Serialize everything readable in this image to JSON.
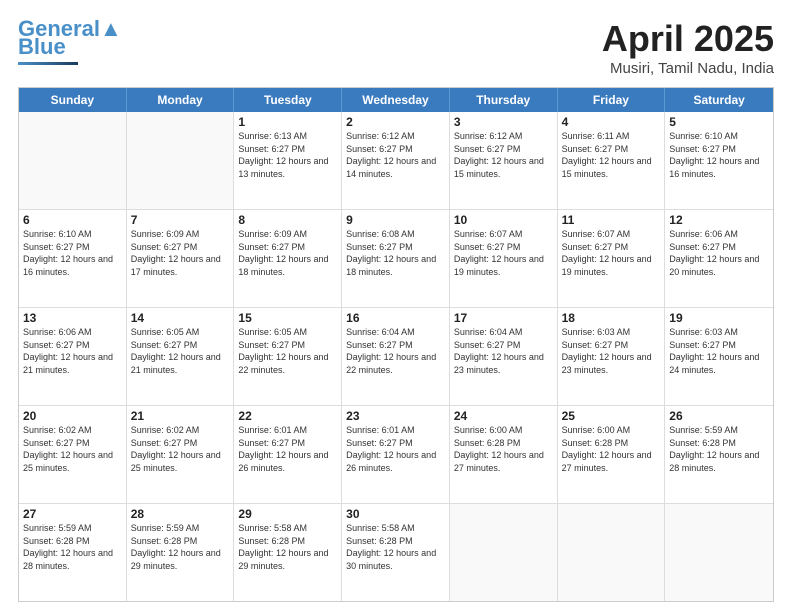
{
  "header": {
    "logo_line1": "General",
    "logo_line2": "Blue",
    "title": "April 2025",
    "subtitle": "Musiri, Tamil Nadu, India"
  },
  "days_of_week": [
    "Sunday",
    "Monday",
    "Tuesday",
    "Wednesday",
    "Thursday",
    "Friday",
    "Saturday"
  ],
  "weeks": [
    [
      {
        "day": "",
        "info": ""
      },
      {
        "day": "",
        "info": ""
      },
      {
        "day": "1",
        "info": "Sunrise: 6:13 AM\nSunset: 6:27 PM\nDaylight: 12 hours and 13 minutes."
      },
      {
        "day": "2",
        "info": "Sunrise: 6:12 AM\nSunset: 6:27 PM\nDaylight: 12 hours and 14 minutes."
      },
      {
        "day": "3",
        "info": "Sunrise: 6:12 AM\nSunset: 6:27 PM\nDaylight: 12 hours and 15 minutes."
      },
      {
        "day": "4",
        "info": "Sunrise: 6:11 AM\nSunset: 6:27 PM\nDaylight: 12 hours and 15 minutes."
      },
      {
        "day": "5",
        "info": "Sunrise: 6:10 AM\nSunset: 6:27 PM\nDaylight: 12 hours and 16 minutes."
      }
    ],
    [
      {
        "day": "6",
        "info": "Sunrise: 6:10 AM\nSunset: 6:27 PM\nDaylight: 12 hours and 16 minutes."
      },
      {
        "day": "7",
        "info": "Sunrise: 6:09 AM\nSunset: 6:27 PM\nDaylight: 12 hours and 17 minutes."
      },
      {
        "day": "8",
        "info": "Sunrise: 6:09 AM\nSunset: 6:27 PM\nDaylight: 12 hours and 18 minutes."
      },
      {
        "day": "9",
        "info": "Sunrise: 6:08 AM\nSunset: 6:27 PM\nDaylight: 12 hours and 18 minutes."
      },
      {
        "day": "10",
        "info": "Sunrise: 6:07 AM\nSunset: 6:27 PM\nDaylight: 12 hours and 19 minutes."
      },
      {
        "day": "11",
        "info": "Sunrise: 6:07 AM\nSunset: 6:27 PM\nDaylight: 12 hours and 19 minutes."
      },
      {
        "day": "12",
        "info": "Sunrise: 6:06 AM\nSunset: 6:27 PM\nDaylight: 12 hours and 20 minutes."
      }
    ],
    [
      {
        "day": "13",
        "info": "Sunrise: 6:06 AM\nSunset: 6:27 PM\nDaylight: 12 hours and 21 minutes."
      },
      {
        "day": "14",
        "info": "Sunrise: 6:05 AM\nSunset: 6:27 PM\nDaylight: 12 hours and 21 minutes."
      },
      {
        "day": "15",
        "info": "Sunrise: 6:05 AM\nSunset: 6:27 PM\nDaylight: 12 hours and 22 minutes."
      },
      {
        "day": "16",
        "info": "Sunrise: 6:04 AM\nSunset: 6:27 PM\nDaylight: 12 hours and 22 minutes."
      },
      {
        "day": "17",
        "info": "Sunrise: 6:04 AM\nSunset: 6:27 PM\nDaylight: 12 hours and 23 minutes."
      },
      {
        "day": "18",
        "info": "Sunrise: 6:03 AM\nSunset: 6:27 PM\nDaylight: 12 hours and 23 minutes."
      },
      {
        "day": "19",
        "info": "Sunrise: 6:03 AM\nSunset: 6:27 PM\nDaylight: 12 hours and 24 minutes."
      }
    ],
    [
      {
        "day": "20",
        "info": "Sunrise: 6:02 AM\nSunset: 6:27 PM\nDaylight: 12 hours and 25 minutes."
      },
      {
        "day": "21",
        "info": "Sunrise: 6:02 AM\nSunset: 6:27 PM\nDaylight: 12 hours and 25 minutes."
      },
      {
        "day": "22",
        "info": "Sunrise: 6:01 AM\nSunset: 6:27 PM\nDaylight: 12 hours and 26 minutes."
      },
      {
        "day": "23",
        "info": "Sunrise: 6:01 AM\nSunset: 6:27 PM\nDaylight: 12 hours and 26 minutes."
      },
      {
        "day": "24",
        "info": "Sunrise: 6:00 AM\nSunset: 6:28 PM\nDaylight: 12 hours and 27 minutes."
      },
      {
        "day": "25",
        "info": "Sunrise: 6:00 AM\nSunset: 6:28 PM\nDaylight: 12 hours and 27 minutes."
      },
      {
        "day": "26",
        "info": "Sunrise: 5:59 AM\nSunset: 6:28 PM\nDaylight: 12 hours and 28 minutes."
      }
    ],
    [
      {
        "day": "27",
        "info": "Sunrise: 5:59 AM\nSunset: 6:28 PM\nDaylight: 12 hours and 28 minutes."
      },
      {
        "day": "28",
        "info": "Sunrise: 5:59 AM\nSunset: 6:28 PM\nDaylight: 12 hours and 29 minutes."
      },
      {
        "day": "29",
        "info": "Sunrise: 5:58 AM\nSunset: 6:28 PM\nDaylight: 12 hours and 29 minutes."
      },
      {
        "day": "30",
        "info": "Sunrise: 5:58 AM\nSunset: 6:28 PM\nDaylight: 12 hours and 30 minutes."
      },
      {
        "day": "",
        "info": ""
      },
      {
        "day": "",
        "info": ""
      },
      {
        "day": "",
        "info": ""
      }
    ]
  ]
}
